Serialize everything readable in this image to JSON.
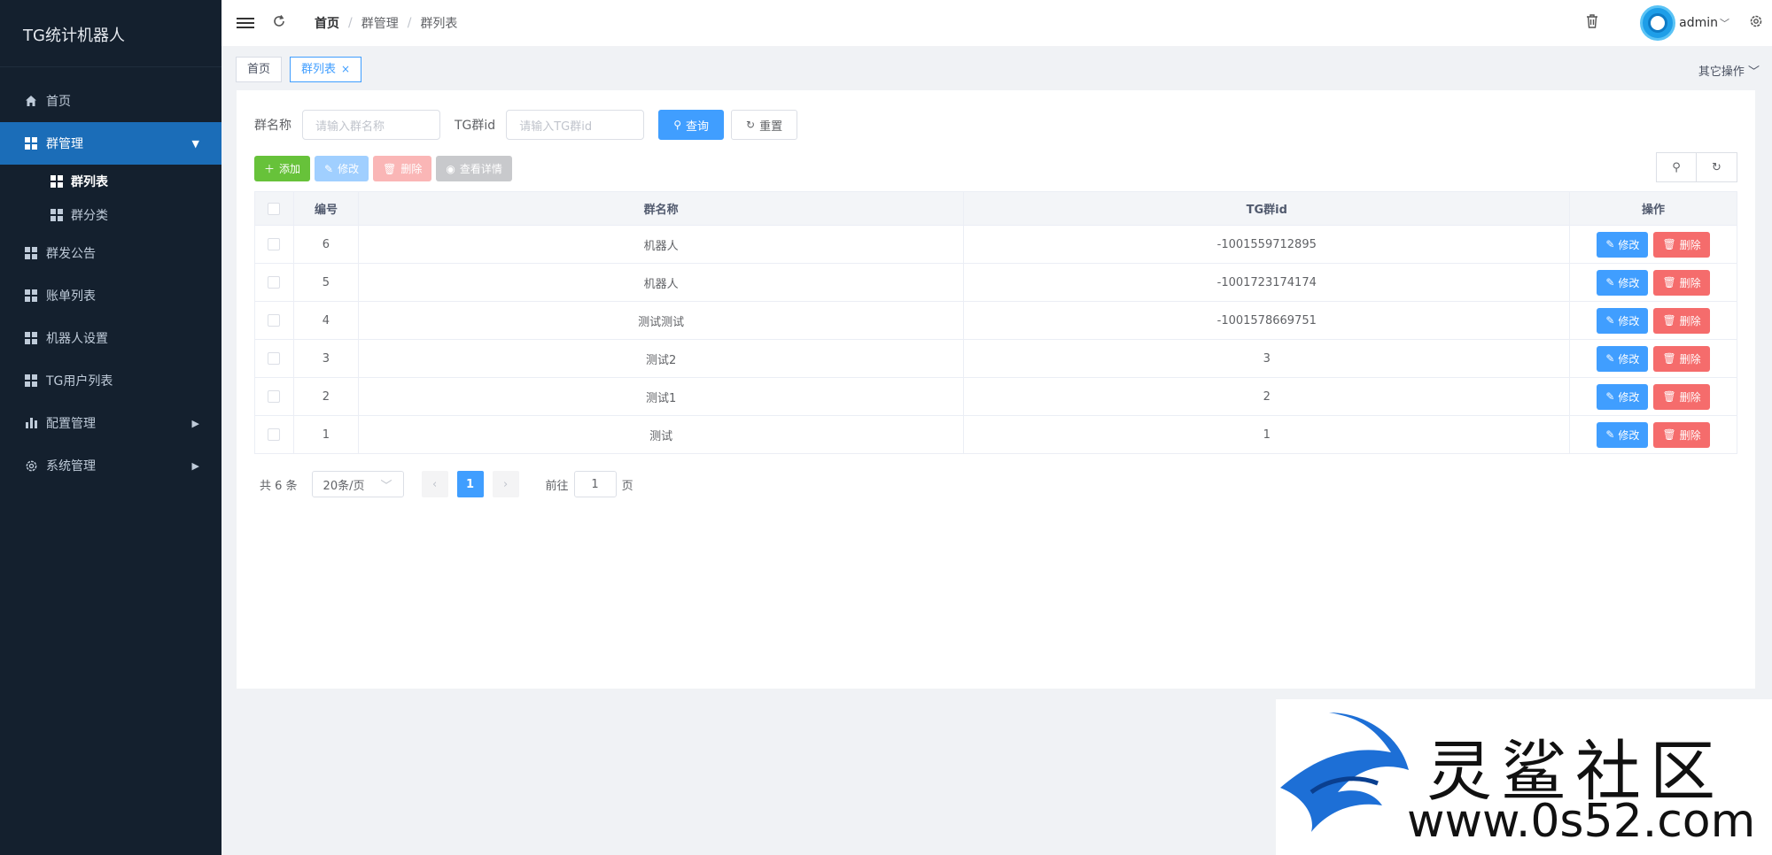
{
  "sidebar": {
    "logo": "TG统计机器人",
    "items": [
      {
        "label": "首页"
      },
      {
        "label": "群管理"
      },
      {
        "label": "群发公告"
      },
      {
        "label": "账单列表"
      },
      {
        "label": "机器人设置"
      },
      {
        "label": "TG用户列表"
      },
      {
        "label": "配置管理"
      },
      {
        "label": "系统管理"
      }
    ],
    "sub": [
      {
        "label": "群列表"
      },
      {
        "label": "群分类"
      }
    ]
  },
  "header": {
    "breadcrumb": [
      "首页",
      "群管理",
      "群列表"
    ],
    "user": "admin"
  },
  "tags": {
    "home": "首页",
    "current": "群列表",
    "other_ops": "其它操作"
  },
  "search": {
    "name_label": "群名称",
    "name_placeholder": "请输入群名称",
    "id_label": "TG群id",
    "id_placeholder": "请输入TG群id",
    "query": "查询",
    "reset": "重置"
  },
  "toolbar": {
    "add": "添加",
    "edit": "修改",
    "delete": "删除",
    "detail": "查看详情"
  },
  "table": {
    "columns": [
      "编号",
      "群名称",
      "TG群id",
      "操作"
    ],
    "rows": [
      {
        "id": "6",
        "name": "机器人",
        "tgid": "-1001559712895"
      },
      {
        "id": "5",
        "name": "机器人",
        "tgid": "-1001723174174"
      },
      {
        "id": "4",
        "name": "测试测试",
        "tgid": "-1001578669751"
      },
      {
        "id": "3",
        "name": "测试2",
        "tgid": "3"
      },
      {
        "id": "2",
        "name": "测试1",
        "tgid": "2"
      },
      {
        "id": "1",
        "name": "测试",
        "tgid": "1"
      }
    ],
    "row_edit": "修改",
    "row_delete": "删除"
  },
  "pager": {
    "total": "共 6 条",
    "size": "20条/页",
    "page": "1",
    "goto_pre": "前往",
    "goto_val": "1",
    "goto_post": "页"
  },
  "watermark": {
    "text": "灵鲨社区",
    "url": "www.0s52.com"
  },
  "colors": {
    "sidebar": "#14202e",
    "active": "#1b6db8",
    "primary": "#409eff",
    "success": "#67c23a",
    "danger": "#f56c6c"
  }
}
